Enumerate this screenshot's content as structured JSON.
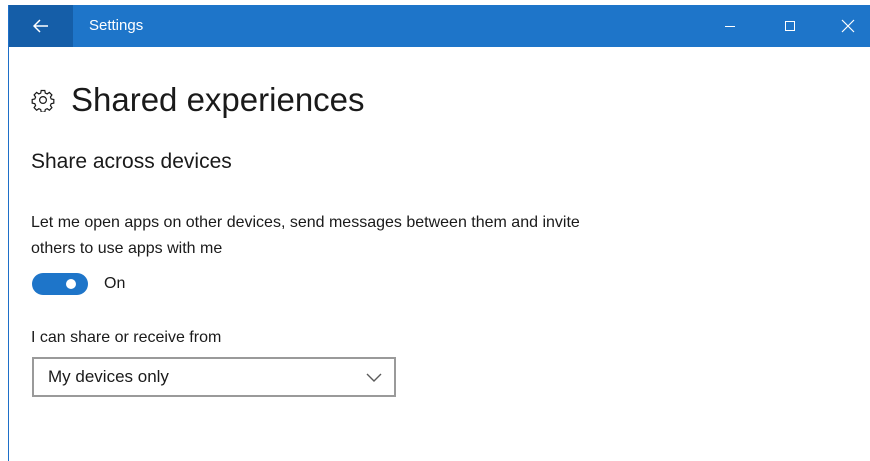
{
  "window": {
    "title": "Settings",
    "accent": "#1e75c9",
    "back_button_color": "#155ea8",
    "controls": [
      "minimize-icon",
      "maximize-icon",
      "close-icon"
    ]
  },
  "page": {
    "title": "Shared experiences",
    "title_icon": "gear-icon"
  },
  "section": {
    "title": "Share across devices",
    "description": "Let me open apps on other devices, send messages between them and invite others to use apps with me"
  },
  "toggle": {
    "state": "On",
    "checked": true
  },
  "share_from": {
    "label": "I can share or receive from",
    "selected": "My devices only"
  }
}
